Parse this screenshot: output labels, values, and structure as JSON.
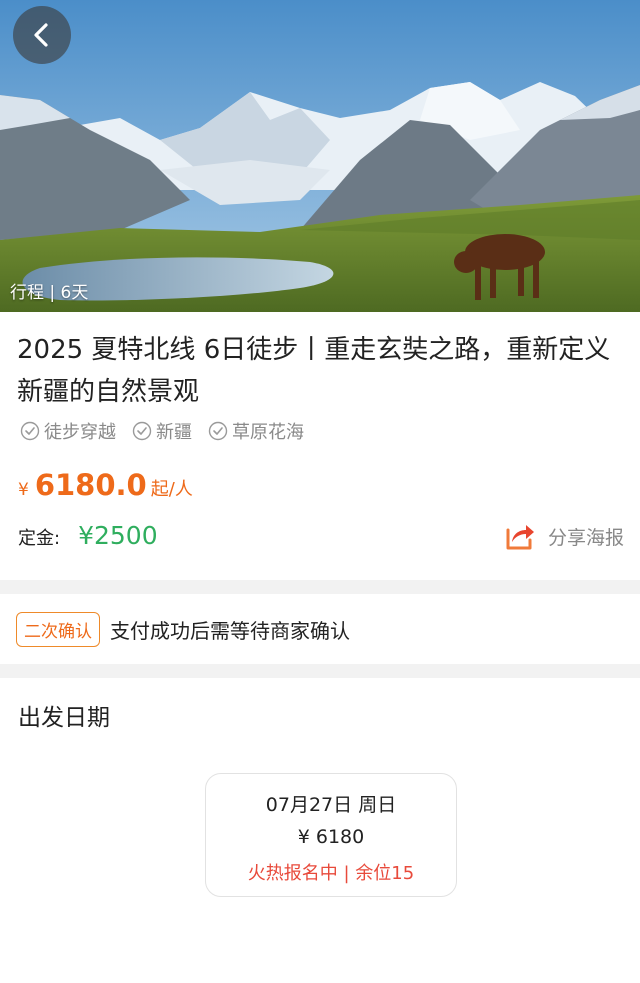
{
  "hero": {
    "back_icon": "chevron-left-icon",
    "tag_text": "行程 | 6天"
  },
  "product": {
    "title": "2025 夏特北线 6日徒步丨重走玄奘之路，重新定义新疆的自然景观",
    "tags": [
      "徒步穿越",
      "新疆",
      "草原花海"
    ],
    "tag_icon": "check-circle-icon",
    "price_currency": "¥",
    "price_value": "6180.0",
    "price_unit": "起/人",
    "deposit_label": "定金:",
    "deposit_value": "¥2500",
    "share_label": "分享海报",
    "share_icon": "share-icon"
  },
  "confirm": {
    "badge": "二次确认",
    "text": "支付成功后需等待商家确认"
  },
  "departure": {
    "title": "出发日期",
    "dates": [
      {
        "date": "07月27日 周日",
        "price": "¥ 6180",
        "status": "火热报名中 | 余位15"
      }
    ]
  },
  "colors": {
    "price": "#ee6a1a",
    "deposit": "#2fae5e",
    "status": "#e84a3b",
    "badge_border": "#ee8a2a"
  }
}
